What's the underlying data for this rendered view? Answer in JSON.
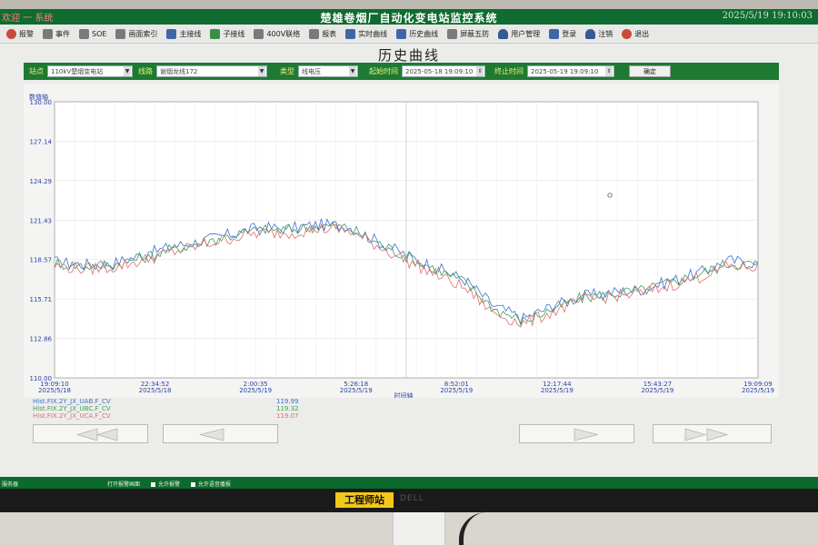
{
  "window": {
    "title": "楚雄卷烟厂自动化变电站监控系统",
    "left_fragment": "欢迎 一 系统",
    "datetime": "2025/5/19   19:10:03"
  },
  "toolbar": {
    "items": [
      {
        "label": "报警",
        "icon": "alarm-icon"
      },
      {
        "label": "事件",
        "icon": "event-icon"
      },
      {
        "label": "SOE",
        "icon": "soe-icon"
      },
      {
        "label": "画面索引",
        "icon": "screen-index-icon"
      },
      {
        "label": "主接线",
        "icon": "main-wiring-icon"
      },
      {
        "label": "子接线",
        "icon": "sub-wiring-icon"
      },
      {
        "label": "400V联络",
        "icon": "tie-icon"
      },
      {
        "label": "报表",
        "icon": "report-icon"
      },
      {
        "label": "实时曲线",
        "icon": "realtime-curve-icon"
      },
      {
        "label": "历史曲线",
        "icon": "history-curve-icon"
      },
      {
        "label": "屏蔽五防",
        "icon": "shield-icon"
      },
      {
        "label": "用户管理",
        "icon": "user-manage-icon"
      },
      {
        "label": "登录",
        "icon": "login-icon"
      },
      {
        "label": "注销",
        "icon": "logout-user-icon"
      },
      {
        "label": "退出",
        "icon": "power-icon"
      }
    ]
  },
  "page": {
    "title": "历史曲线"
  },
  "filters": {
    "station_label": "站点",
    "station_value": "110kV楚烟变电站",
    "line_label": "线路",
    "line_value": "谢烟龙线172",
    "type_label": "类型",
    "type_value": "线电压",
    "start_label": "起始时间",
    "start_value": "2025-05-18 19:09:10",
    "end_label": "终止时间",
    "end_value": "2025-05-19 19:09:10",
    "ok_label": "确定"
  },
  "chart_data": {
    "type": "line",
    "ylabel": "数值轴",
    "xlabel": "时间轴",
    "ylim": [
      110.0,
      130.0
    ],
    "yticks": [
      "130.00",
      "127.14",
      "124.29",
      "121.43",
      "118.57",
      "115.71",
      "112.86",
      "110.00"
    ],
    "x_ticks": [
      {
        "time": "19:09:10",
        "date": "2025/5/18"
      },
      {
        "time": "22:34:52",
        "date": "2025/5/18"
      },
      {
        "time": "2:00:35",
        "date": "2025/5/19"
      },
      {
        "time": "5:26:18",
        "date": "2025/5/19"
      },
      {
        "time": "8:52:01",
        "date": "2025/5/19"
      },
      {
        "time": "12:17:44",
        "date": "2025/5/19"
      },
      {
        "time": "15:43:27",
        "date": "2025/5/19"
      },
      {
        "time": "19:09:09",
        "date": "2025/5/19"
      }
    ],
    "grid": true,
    "series": [
      {
        "name": "Hist.FIX.2Y_JX_UAB.F_CV",
        "color": "#3f6fd6",
        "values": [
          118.4,
          118.2,
          118.3,
          118.9,
          119.5,
          119.9,
          120.4,
          120.9,
          120.8,
          121.1,
          121.0,
          119.9,
          118.9,
          118.0,
          117.1,
          115.2,
          114.3,
          115.2,
          115.9,
          116.2,
          116.4,
          117.0,
          117.6,
          118.5,
          118.3
        ]
      },
      {
        "name": "Hist.FIX.2Y_JX_UBC.F_CV",
        "color": "#3e9e58",
        "values": [
          118.3,
          118.1,
          118.2,
          118.7,
          119.3,
          119.8,
          120.3,
          120.7,
          120.7,
          121.0,
          120.9,
          119.8,
          118.8,
          117.9,
          116.9,
          115.0,
          114.1,
          115.0,
          115.8,
          116.1,
          116.3,
          116.9,
          117.5,
          118.3,
          118.2
        ]
      },
      {
        "name": "Hist.FIX.2Y_JX_UCA.F_CV",
        "color": "#e0706a",
        "values": [
          118.1,
          117.9,
          118.0,
          118.5,
          119.1,
          119.6,
          120.1,
          120.5,
          120.5,
          120.8,
          120.7,
          119.6,
          118.5,
          117.5,
          116.5,
          114.7,
          113.9,
          114.8,
          115.6,
          115.9,
          116.1,
          116.7,
          117.3,
          118.1,
          118.0
        ]
      }
    ],
    "current_values": [
      "119.99",
      "119.32",
      "119.07"
    ]
  },
  "status": {
    "left": "服务器",
    "mid": "打开报警画面",
    "opt1": "允许报警",
    "opt2": "允许语音播报"
  },
  "bezel": {
    "label": "工程师站",
    "brand": "DELL"
  }
}
